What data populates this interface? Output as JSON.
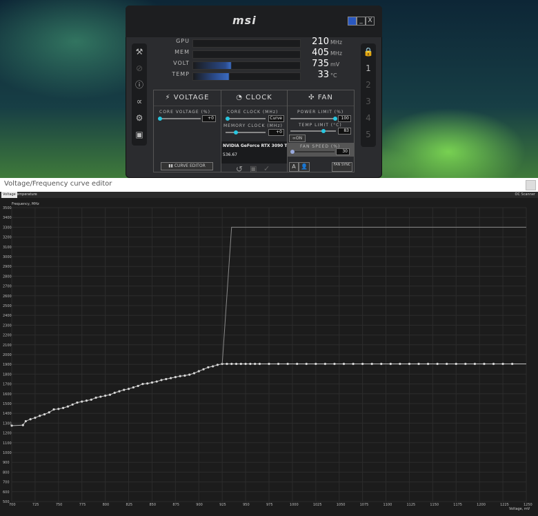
{
  "afterburner": {
    "logo": "msi",
    "window_controls": [
      "",
      "_",
      "X"
    ],
    "monitors": [
      {
        "label": "GPU",
        "value": "210",
        "unit": "MHz"
      },
      {
        "label": "MEM",
        "value": "405",
        "unit": "MHz"
      },
      {
        "label": "VOLT",
        "value": "735",
        "unit": "mV"
      },
      {
        "label": "TEMP",
        "value": "33",
        "unit": "°C"
      }
    ],
    "profiles": [
      "1",
      "2",
      "3",
      "4",
      "5"
    ],
    "voltage": {
      "title": "VOLTAGE",
      "core_voltage_label": "CORE VOLTAGE  (%)",
      "core_voltage_value": "+0",
      "curve_editor": "CURVE EDITOR"
    },
    "clock": {
      "title": "CLOCK",
      "core_clock_label": "CORE CLOCK (MHz)",
      "core_clock_value": "Curve",
      "memory_clock_label": "MEMORY CLOCK  (MHz)",
      "memory_clock_value": "+0",
      "gpu_name": "NVIDIA GeForce RTX 3090 Ti",
      "driver": "536.67"
    },
    "fan": {
      "title": "FAN",
      "power_limit_label": "POWER LIMIT  (%)",
      "power_limit_value": "100",
      "temp_limit_label": "TEMP LIMIT  (°C)",
      "temp_limit_value": "83",
      "link_label": "ON",
      "fan_speed_label": "FAN SPEED (%)",
      "fan_speed_value": "30",
      "auto_label": "A",
      "fan_sync": "FAN SYNC"
    }
  },
  "curve_editor": {
    "title": "Voltage/Frequency curve editor",
    "tabs": [
      "Voltage",
      "Temperature"
    ],
    "oc_scanner": "OC Scanner",
    "chart_data": {
      "type": "line",
      "ylabel": "Frequency, MHz",
      "xlabel": "Voltage, mV",
      "xlim": [
        700,
        1250
      ],
      "ylim": [
        500,
        1500
      ],
      "x_ticks": [
        700,
        725,
        750,
        775,
        800,
        825,
        850,
        875,
        900,
        925,
        950,
        975,
        1000,
        1025,
        1050,
        1075,
        1100,
        1125,
        1150,
        1175,
        1200,
        1225,
        1250
      ],
      "y_ticks": [
        500,
        600,
        700,
        800,
        900,
        1000,
        1100,
        1200,
        1300,
        1400,
        1500,
        1600,
        1700,
        1800,
        1900,
        2000,
        2100,
        2200,
        2300,
        2400,
        2500,
        2600,
        2700,
        2800,
        2900,
        3000,
        3100,
        3200,
        3300,
        3400,
        3500
      ],
      "series": [
        {
          "name": "",
          "x": [
            700,
            712,
            715,
            720,
            725,
            730,
            735,
            740,
            745,
            750,
            755,
            760,
            765,
            770,
            775,
            780,
            785,
            790,
            795,
            800,
            805,
            810,
            815,
            820,
            825,
            830,
            835,
            840,
            845,
            850,
            855,
            860,
            865,
            870,
            875,
            880,
            885,
            890,
            895,
            900,
            905,
            910,
            915,
            920,
            925,
            930,
            935,
            940,
            945,
            950,
            955,
            960,
            965,
            975,
            985,
            995,
            1005,
            1015,
            1025,
            1035,
            1045,
            1055,
            1065,
            1075,
            1085,
            1095,
            1105,
            1115,
            1125,
            1135,
            1145,
            1155,
            1165,
            1175,
            1185,
            1195,
            1205,
            1215,
            1225,
            1235,
            1250
          ],
          "y": [
            1275,
            1280,
            1320,
            1340,
            1355,
            1375,
            1390,
            1410,
            1440,
            1445,
            1455,
            1470,
            1490,
            1510,
            1520,
            1530,
            1540,
            1560,
            1570,
            1580,
            1590,
            1610,
            1625,
            1640,
            1650,
            1665,
            1680,
            1700,
            1705,
            1715,
            1725,
            1740,
            1750,
            1760,
            1770,
            1780,
            1785,
            1795,
            1810,
            1830,
            1850,
            1870,
            1880,
            1895,
            1905,
            1905,
            1905,
            1905,
            1905,
            1905,
            1905,
            1905,
            1905,
            1905,
            1905,
            1905,
            1905,
            1905,
            1905,
            1905,
            1905,
            1905,
            1905,
            1905,
            1905,
            1905,
            1905,
            1905,
            1905,
            1905,
            1905,
            1905,
            1905,
            1905,
            1905,
            1905,
            1905,
            1905,
            1905,
            1905,
            1905
          ]
        },
        {
          "name": "",
          "x": [
            925,
            930,
            935,
            1250
          ],
          "y": [
            1905,
            2600,
            3300,
            3300
          ]
        }
      ]
    }
  }
}
